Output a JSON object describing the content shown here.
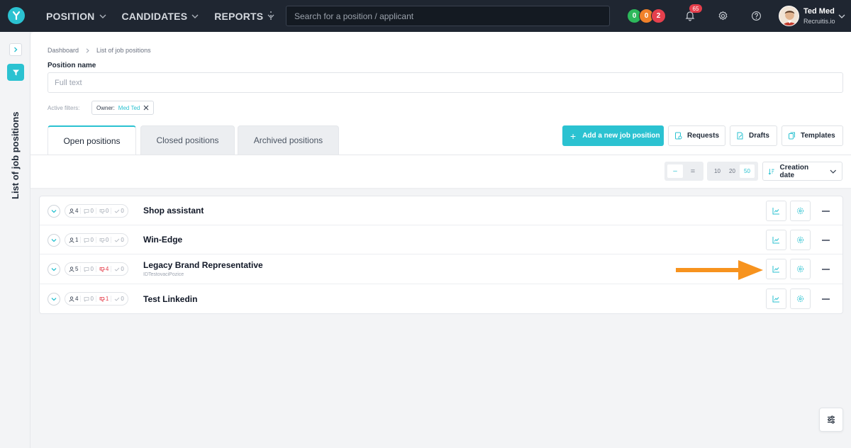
{
  "header": {
    "nav": [
      {
        "label": "POSITION"
      },
      {
        "label": "CANDIDATES"
      },
      {
        "label": "REPORTS"
      }
    ],
    "search_placeholder": "Search for a position / applicant",
    "status_counts": [
      {
        "value": "0",
        "color": "#2db85b"
      },
      {
        "value": "0",
        "color": "#f0812a"
      },
      {
        "value": "2",
        "color": "#e5404d"
      }
    ],
    "notification_count": "65",
    "user": {
      "name": "Ted Med",
      "org": "Recruitis.io"
    }
  },
  "sidebar": {
    "title": "List of job positions"
  },
  "filters": {
    "breadcrumb": [
      "Dashboard",
      "List of job positions"
    ],
    "position_name_label": "Position name",
    "full_text_placeholder": "Full text",
    "active_filters_label": "Active filters:",
    "chip": {
      "key": "Owner:",
      "value": "Med Ted"
    }
  },
  "tabs": [
    {
      "label": "Open positions",
      "active": true
    },
    {
      "label": "Closed positions",
      "active": false
    },
    {
      "label": "Archived positions",
      "active": false
    }
  ],
  "actions": {
    "add": "Add a new job position",
    "requests": "Requests",
    "drafts": "Drafts",
    "templates": "Templates"
  },
  "toolbar": {
    "view_compact": "–",
    "view_expanded": "=",
    "page_sizes": [
      "10",
      "20",
      "50"
    ],
    "page_size_selected": "50",
    "sort_label": "Creation date"
  },
  "positions": [
    {
      "title": "Shop assistant",
      "subtitle": "",
      "candidates": "4",
      "comments": "0",
      "rejected": "0",
      "hired": "0"
    },
    {
      "title": "Win-Edge",
      "subtitle": "",
      "candidates": "1",
      "comments": "0",
      "rejected": "0",
      "hired": "0"
    },
    {
      "title": "Legacy Brand Representative",
      "subtitle": "IDTestovaciPozice",
      "candidates": "5",
      "comments": "0",
      "rejected": "4",
      "hired": "0"
    },
    {
      "title": "Test Linkedin",
      "subtitle": "",
      "candidates": "4",
      "comments": "0",
      "rejected": "1",
      "hired": "0"
    }
  ],
  "colors": {
    "accent": "#2bc2d1",
    "arrow": "#f7931e",
    "topbar": "#1f2631"
  }
}
